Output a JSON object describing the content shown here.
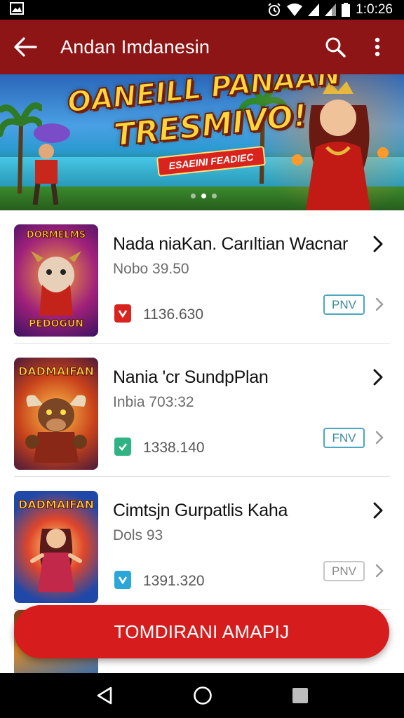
{
  "status_bar": {
    "time": "1:0:26",
    "icons": [
      "gallery-icon",
      "alarm-icon",
      "wifi-icon",
      "signal-icon",
      "signal-icon",
      "battery-icon"
    ]
  },
  "app_bar": {
    "title": "Andan Imdanesin",
    "back_icon": "arrow-left-icon",
    "search_icon": "search-icon",
    "menu_icon": "more-vert-icon"
  },
  "banner": {
    "title_line1": "OANEILL PANAAN",
    "title_line2": "TRESMIVO!",
    "tagline": "ESAEINI FEADIEC",
    "dots": 3,
    "active_dot": 1
  },
  "games": [
    {
      "name": "Nada niaKan. Carıltian Wacnar",
      "sub": "Nobo 39.50",
      "count": "1136.630",
      "badge_color": "#d8231f",
      "pill": "PNV",
      "pill_style": "blue",
      "thumb_top": "DORMELMS",
      "thumb_bottom": "PEDOGUN"
    },
    {
      "name": "Nania 'cr SundpPlan",
      "sub": "Inbia 703:32",
      "count": "1338.140",
      "badge_color": "#2fb383",
      "pill": "FNV",
      "pill_style": "blue",
      "thumb_top": "DADMAIFAN",
      "thumb_bottom": ""
    },
    {
      "name": "Cimtsjn Gurpatlis Kaha",
      "sub": "Dols 93",
      "count": "1391.320",
      "badge_color": "#2aa6d8",
      "pill": "PNV",
      "pill_style": "grey",
      "thumb_top": "DADMAIFAN",
      "thumb_bottom": ""
    }
  ],
  "cta": {
    "label": "TOMDIRANI AMAPIJ"
  },
  "nav": {
    "back_icon": "nav-back-icon",
    "home_icon": "nav-home-icon",
    "recents_icon": "nav-recents-icon"
  }
}
